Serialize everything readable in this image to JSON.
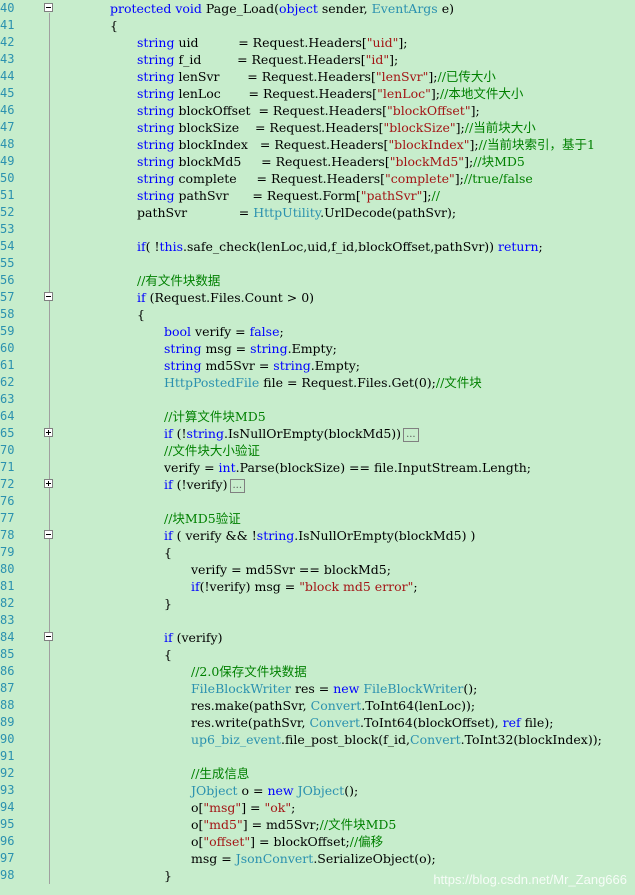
{
  "colors": {
    "background": "#c7edcc",
    "keyword": "#0000ff",
    "type": "#2b91af",
    "string": "#a31515",
    "comment": "#008000",
    "plain": "#000000",
    "line_number": "#2b91af"
  },
  "editor": {
    "lines": [
      {
        "num": "40",
        "fold": "collapse",
        "indent": 0,
        "segs": [
          [
            "protected void",
            "kw"
          ],
          [
            " Page_Load(",
            ""
          ],
          [
            "object",
            "kw"
          ],
          [
            " sender, ",
            ""
          ],
          [
            "EventArgs",
            "ty"
          ],
          [
            " e)",
            ""
          ]
        ]
      },
      {
        "num": "41",
        "indent": 0,
        "segs": [
          [
            "{",
            ""
          ]
        ]
      },
      {
        "num": "42",
        "indent": 1,
        "segs": [
          [
            "string",
            "kw"
          ],
          [
            " uid          = Request.Headers[",
            ""
          ],
          [
            "\"uid\"",
            "st"
          ],
          [
            "];",
            ""
          ]
        ]
      },
      {
        "num": "43",
        "indent": 1,
        "segs": [
          [
            "string",
            "kw"
          ],
          [
            " f_id         = Request.Headers[",
            ""
          ],
          [
            "\"id\"",
            "st"
          ],
          [
            "];",
            ""
          ]
        ]
      },
      {
        "num": "44",
        "indent": 1,
        "segs": [
          [
            "string",
            "kw"
          ],
          [
            " lenSvr       = Request.Headers[",
            ""
          ],
          [
            "\"lenSvr\"",
            "st"
          ],
          [
            "];",
            ""
          ],
          [
            "//已传大小",
            "cm"
          ]
        ]
      },
      {
        "num": "45",
        "indent": 1,
        "segs": [
          [
            "string",
            "kw"
          ],
          [
            " lenLoc       = Request.Headers[",
            ""
          ],
          [
            "\"lenLoc\"",
            "st"
          ],
          [
            "];",
            ""
          ],
          [
            "//本地文件大小",
            "cm"
          ]
        ]
      },
      {
        "num": "46",
        "indent": 1,
        "segs": [
          [
            "string",
            "kw"
          ],
          [
            " blockOffset  = Request.Headers[",
            ""
          ],
          [
            "\"blockOffset\"",
            "st"
          ],
          [
            "];",
            ""
          ]
        ]
      },
      {
        "num": "47",
        "indent": 1,
        "segs": [
          [
            "string",
            "kw"
          ],
          [
            " blockSize    = Request.Headers[",
            ""
          ],
          [
            "\"blockSize\"",
            "st"
          ],
          [
            "];",
            ""
          ],
          [
            "//当前块大小",
            "cm"
          ]
        ]
      },
      {
        "num": "48",
        "indent": 1,
        "segs": [
          [
            "string",
            "kw"
          ],
          [
            " blockIndex   = Request.Headers[",
            ""
          ],
          [
            "\"blockIndex\"",
            "st"
          ],
          [
            "];",
            ""
          ],
          [
            "//当前块索引，基于1",
            "cm"
          ]
        ]
      },
      {
        "num": "49",
        "indent": 1,
        "segs": [
          [
            "string",
            "kw"
          ],
          [
            " blockMd5     = Request.Headers[",
            ""
          ],
          [
            "\"blockMd5\"",
            "st"
          ],
          [
            "];",
            ""
          ],
          [
            "//块MD5",
            "cm"
          ]
        ]
      },
      {
        "num": "50",
        "indent": 1,
        "segs": [
          [
            "string",
            "kw"
          ],
          [
            " complete     = Request.Headers[",
            ""
          ],
          [
            "\"complete\"",
            "st"
          ],
          [
            "];",
            ""
          ],
          [
            "//true/false",
            "cm"
          ]
        ]
      },
      {
        "num": "51",
        "indent": 1,
        "segs": [
          [
            "string",
            "kw"
          ],
          [
            " pathSvr      = Request.Form[",
            ""
          ],
          [
            "\"pathSvr\"",
            "st"
          ],
          [
            "];",
            ""
          ],
          [
            "//",
            "cm"
          ]
        ]
      },
      {
        "num": "52",
        "indent": 1,
        "segs": [
          [
            "pathSvr             = ",
            ""
          ],
          [
            "HttpUtility",
            "ty"
          ],
          [
            ".UrlDecode(pathSvr);",
            ""
          ]
        ]
      },
      {
        "num": "53",
        "indent": 0,
        "segs": []
      },
      {
        "num": "54",
        "indent": 1,
        "segs": [
          [
            "if",
            "kw"
          ],
          [
            "( !",
            ""
          ],
          [
            "this",
            "kw"
          ],
          [
            ".safe_check(lenLoc,uid,f_id,blockOffset,pathSvr)) ",
            ""
          ],
          [
            "return",
            "kw"
          ],
          [
            ";",
            ""
          ]
        ]
      },
      {
        "num": "55",
        "indent": 0,
        "segs": []
      },
      {
        "num": "56",
        "indent": 1,
        "segs": [
          [
            "//有文件块数据",
            "cm"
          ]
        ]
      },
      {
        "num": "57",
        "fold": "collapse",
        "indent": 1,
        "segs": [
          [
            "if",
            "kw"
          ],
          [
            " (Request.Files.Count > 0)",
            ""
          ]
        ]
      },
      {
        "num": "58",
        "indent": 1,
        "segs": [
          [
            "{",
            ""
          ]
        ]
      },
      {
        "num": "59",
        "indent": 2,
        "segs": [
          [
            "bool",
            "kw"
          ],
          [
            " verify = ",
            ""
          ],
          [
            "false",
            "kw"
          ],
          [
            ";",
            ""
          ]
        ]
      },
      {
        "num": "60",
        "indent": 2,
        "segs": [
          [
            "string",
            "kw"
          ],
          [
            " msg = ",
            ""
          ],
          [
            "string",
            "kw"
          ],
          [
            ".Empty;",
            ""
          ]
        ]
      },
      {
        "num": "61",
        "indent": 2,
        "segs": [
          [
            "string",
            "kw"
          ],
          [
            " md5Svr = ",
            ""
          ],
          [
            "string",
            "kw"
          ],
          [
            ".Empty;",
            ""
          ]
        ]
      },
      {
        "num": "62",
        "indent": 2,
        "segs": [
          [
            "HttpPostedFile",
            "ty"
          ],
          [
            " file = Request.Files.Get(0);",
            ""
          ],
          [
            "//文件块",
            "cm"
          ]
        ]
      },
      {
        "num": "63",
        "indent": 0,
        "segs": []
      },
      {
        "num": "64",
        "indent": 2,
        "segs": [
          [
            "//计算文件块MD5",
            "cm"
          ]
        ]
      },
      {
        "num": "65",
        "fold": "expand",
        "indent": 2,
        "segs": [
          [
            "if",
            "kw"
          ],
          [
            " (!",
            ""
          ],
          [
            "string",
            "kw"
          ],
          [
            ".IsNullOrEmpty(blockMd5))",
            ""
          ]
        ],
        "ellipsis": "..."
      },
      {
        "num": "70",
        "indent": 2,
        "segs": [
          [
            "//文件块大小验证",
            "cm"
          ]
        ]
      },
      {
        "num": "71",
        "indent": 2,
        "segs": [
          [
            "verify = ",
            ""
          ],
          [
            "int",
            "kw"
          ],
          [
            ".Parse(blockSize) == file.InputStream.Length;",
            ""
          ]
        ]
      },
      {
        "num": "72",
        "fold": "expand",
        "indent": 2,
        "segs": [
          [
            "if",
            "kw"
          ],
          [
            " (!verify)",
            ""
          ]
        ],
        "ellipsis": "..."
      },
      {
        "num": "76",
        "indent": 0,
        "segs": []
      },
      {
        "num": "77",
        "indent": 2,
        "segs": [
          [
            "//块MD5验证",
            "cm"
          ]
        ]
      },
      {
        "num": "78",
        "fold": "collapse",
        "indent": 2,
        "segs": [
          [
            "if",
            "kw"
          ],
          [
            " ( verify && !",
            ""
          ],
          [
            "string",
            "kw"
          ],
          [
            ".IsNullOrEmpty(blockMd5) )",
            ""
          ]
        ]
      },
      {
        "num": "79",
        "indent": 2,
        "segs": [
          [
            "{",
            ""
          ]
        ]
      },
      {
        "num": "80",
        "indent": 3,
        "segs": [
          [
            "verify = md5Svr == blockMd5;",
            ""
          ]
        ]
      },
      {
        "num": "81",
        "indent": 3,
        "segs": [
          [
            "if",
            "kw"
          ],
          [
            "(!verify) msg = ",
            ""
          ],
          [
            "\"block md5 error\"",
            "st"
          ],
          [
            ";",
            ""
          ]
        ]
      },
      {
        "num": "82",
        "indent": 2,
        "segs": [
          [
            "}",
            ""
          ]
        ]
      },
      {
        "num": "83",
        "indent": 0,
        "segs": []
      },
      {
        "num": "84",
        "fold": "collapse",
        "indent": 2,
        "segs": [
          [
            "if",
            "kw"
          ],
          [
            " (verify)",
            ""
          ]
        ]
      },
      {
        "num": "85",
        "indent": 2,
        "segs": [
          [
            "{",
            ""
          ]
        ]
      },
      {
        "num": "86",
        "indent": 3,
        "segs": [
          [
            "//2.0保存文件块数据",
            "cm"
          ]
        ]
      },
      {
        "num": "87",
        "indent": 3,
        "segs": [
          [
            "FileBlockWriter",
            "ty"
          ],
          [
            " res = ",
            ""
          ],
          [
            "new",
            "kw"
          ],
          [
            " ",
            ""
          ],
          [
            "FileBlockWriter",
            "ty"
          ],
          [
            "();",
            ""
          ]
        ]
      },
      {
        "num": "88",
        "indent": 3,
        "segs": [
          [
            "res.make(pathSvr, ",
            ""
          ],
          [
            "Convert",
            "ty"
          ],
          [
            ".ToInt64(lenLoc));",
            ""
          ]
        ]
      },
      {
        "num": "89",
        "indent": 3,
        "segs": [
          [
            "res.write(pathSvr, ",
            ""
          ],
          [
            "Convert",
            "ty"
          ],
          [
            ".ToInt64(blockOffset), ",
            ""
          ],
          [
            "ref",
            "kw"
          ],
          [
            " file);",
            ""
          ]
        ]
      },
      {
        "num": "90",
        "indent": 3,
        "segs": [
          [
            "up6_biz_event",
            "ty"
          ],
          [
            ".file_post_block(f_id,",
            ""
          ],
          [
            "Convert",
            "ty"
          ],
          [
            ".ToInt32(blockIndex));",
            ""
          ]
        ]
      },
      {
        "num": "91",
        "indent": 0,
        "segs": []
      },
      {
        "num": "92",
        "indent": 3,
        "segs": [
          [
            "//生成信息",
            "cm"
          ]
        ]
      },
      {
        "num": "93",
        "indent": 3,
        "segs": [
          [
            "JObject",
            "ty"
          ],
          [
            " o = ",
            ""
          ],
          [
            "new",
            "kw"
          ],
          [
            " ",
            ""
          ],
          [
            "JObject",
            "ty"
          ],
          [
            "();",
            ""
          ]
        ]
      },
      {
        "num": "94",
        "indent": 3,
        "segs": [
          [
            "o[",
            ""
          ],
          [
            "\"msg\"",
            "st"
          ],
          [
            "] = ",
            ""
          ],
          [
            "\"ok\"",
            "st"
          ],
          [
            ";",
            ""
          ]
        ]
      },
      {
        "num": "95",
        "indent": 3,
        "segs": [
          [
            "o[",
            ""
          ],
          [
            "\"md5\"",
            "st"
          ],
          [
            "] = md5Svr;",
            ""
          ],
          [
            "//文件块MD5",
            "cm"
          ]
        ]
      },
      {
        "num": "96",
        "indent": 3,
        "segs": [
          [
            "o[",
            ""
          ],
          [
            "\"offset\"",
            "st"
          ],
          [
            "] = blockOffset;",
            ""
          ],
          [
            "//偏移",
            "cm"
          ]
        ]
      },
      {
        "num": "97",
        "indent": 3,
        "segs": [
          [
            "msg = ",
            ""
          ],
          [
            "JsonConvert",
            "ty"
          ],
          [
            ".SerializeObject(o);",
            ""
          ]
        ]
      },
      {
        "num": "98",
        "indent": 2,
        "segs": [
          [
            "}",
            ""
          ]
        ]
      }
    ]
  },
  "watermark": "https://blog.csdn.net/Mr_Zang666"
}
